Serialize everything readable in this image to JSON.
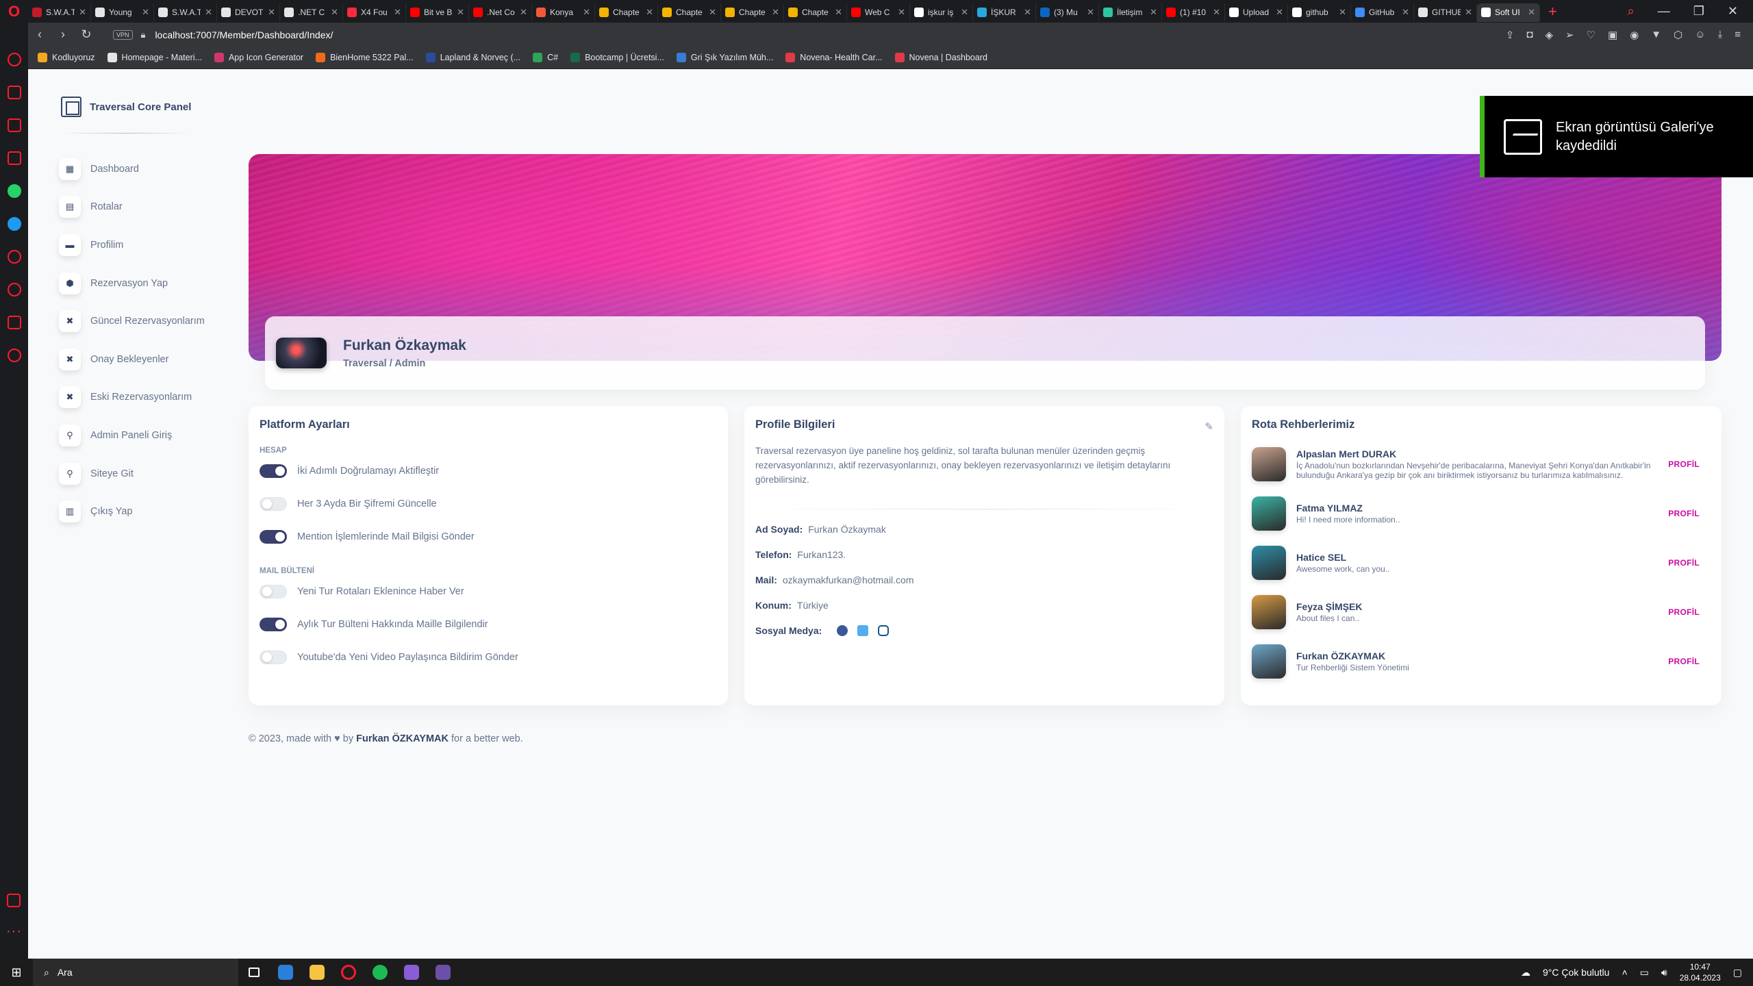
{
  "browser": {
    "tabs": [
      {
        "label": "S.W.A.T.",
        "color": "#c5192d"
      },
      {
        "label": "Young",
        "color": "#e5e5e5"
      },
      {
        "label": "S.W.A.T.",
        "color": "#e5e5e5"
      },
      {
        "label": "DEVOT",
        "color": "#e5e5e5"
      },
      {
        "label": ".NET C",
        "color": "#e5e5e5"
      },
      {
        "label": "X4 Fou",
        "color": "#ff2a3a"
      },
      {
        "label": "Bit ve B",
        "color": "#ff0000"
      },
      {
        "label": ".Net Co",
        "color": "#ff0000"
      },
      {
        "label": "Konya",
        "color": "#f05a3a"
      },
      {
        "label": "Chapte",
        "color": "#f2b400"
      },
      {
        "label": "Chapte",
        "color": "#f2b400"
      },
      {
        "label": "Chapte",
        "color": "#f2b400"
      },
      {
        "label": "Chapte",
        "color": "#f2b400"
      },
      {
        "label": "Web C",
        "color": "#ff0000"
      },
      {
        "label": "işkur iş",
        "color": "#ffffff"
      },
      {
        "label": "İŞKUR",
        "color": "#2aa6e0"
      },
      {
        "label": "(3) Mu",
        "color": "#0a66c2"
      },
      {
        "label": "İletişim",
        "color": "#2ec5a5"
      },
      {
        "label": "(1) #10",
        "color": "#ff0000"
      },
      {
        "label": "Upload",
        "color": "#ffffff"
      },
      {
        "label": "github",
        "color": "#ffffff"
      },
      {
        "label": "GitHub",
        "color": "#3d8bfd"
      },
      {
        "label": "GITHUB",
        "color": "#e5e5e5"
      },
      {
        "label": "Soft UI",
        "color": "#ffffff",
        "active": true
      }
    ],
    "url": "localhost:7007/Member/Dashboard/Index/",
    "vpn_label": "VPN",
    "bookmarks": [
      {
        "label": "Kodluyoruz",
        "color": "#f5a623"
      },
      {
        "label": "Homepage - Materi...",
        "color": "#e5e5e5"
      },
      {
        "label": "App Icon Generator",
        "color": "#d0386c"
      },
      {
        "label": "BienHome 5322 Pal...",
        "color": "#f06a1a"
      },
      {
        "label": "Lapland & Norveç (...",
        "color": "#2b4b9b"
      },
      {
        "label": "C#",
        "color": "#2ea35a"
      },
      {
        "label": "Bootcamp | Ücretsi...",
        "color": "#1a6a4a"
      },
      {
        "label": "Gri Şık Yazılım Müh...",
        "color": "#3a7bd5"
      },
      {
        "label": "Novena- Health Car...",
        "color": "#e23a4a"
      },
      {
        "label": "Novena | Dashboard",
        "color": "#e23a4a"
      }
    ]
  },
  "brand": {
    "title": "Traversal Core Panel"
  },
  "sidebar": {
    "items": [
      {
        "label": "Dashboard",
        "icon": "store-icon"
      },
      {
        "label": "Rotalar",
        "icon": "chart-icon"
      },
      {
        "label": "Profilim",
        "icon": "card-icon"
      },
      {
        "label": "Rezervasyon Yap",
        "icon": "box-icon"
      },
      {
        "label": "Güncel Rezervasyonlarım",
        "icon": "tools-icon"
      },
      {
        "label": "Onay Bekleyenler",
        "icon": "tools-icon"
      },
      {
        "label": "Eski Rezervasyonlarım",
        "icon": "tools-icon"
      },
      {
        "label": "Admin Paneli Giriş",
        "icon": "user-plus-icon"
      },
      {
        "label": "Siteye Git",
        "icon": "user-plus-icon"
      },
      {
        "label": "Çıkış Yap",
        "icon": "document-icon"
      }
    ]
  },
  "profile": {
    "name": "Furkan Özkaymak",
    "role": "Traversal / Admin"
  },
  "platform": {
    "title": "Platform Ayarları",
    "account_label": "HESAP",
    "account_settings": [
      {
        "label": "İki Adımlı Doğrulamayı Aktifleştir",
        "enabled": true
      },
      {
        "label": "Her 3 Ayda Bir Şifremi Güncelle",
        "enabled": false
      },
      {
        "label": "Mention İşlemlerinde Mail Bilgisi Gönder",
        "enabled": true
      }
    ],
    "mail_label": "MAIL BÜLTENİ",
    "mail_settings": [
      {
        "label": "Yeni Tur Rotaları Eklenince Haber Ver",
        "enabled": false
      },
      {
        "label": "Aylık Tur Bülteni Hakkında Maille Bilgilendir",
        "enabled": true
      },
      {
        "label": "Youtube'da Yeni Video Paylaşınca Bildirim Gönder",
        "enabled": false
      }
    ]
  },
  "profile_info": {
    "title": "Profile Bilgileri",
    "description": "Traversal rezervasyon üye paneline hoş geldiniz, sol tarafta bulunan menüler üzerinden geçmiş rezervasyonlarınızı, aktif rezervasyonlarınızı, onay bekleyen rezervasyonlarınızı ve iletişim detaylarını görebilirsiniz.",
    "fields": [
      {
        "key": "Ad Soyad:",
        "value": "Furkan Özkaymak"
      },
      {
        "key": "Telefon:",
        "value": "Furkan123."
      },
      {
        "key": "Mail:",
        "value": "ozkaymakfurkan@hotmail.com"
      },
      {
        "key": "Konum:",
        "value": "Türkiye"
      }
    ],
    "social_label": "Sosyal Medya:"
  },
  "guides": {
    "title": "Rota Rehberlerimiz",
    "button_label": "PROFİL",
    "items": [
      {
        "name": "Alpaslan Mert DURAK",
        "desc": "İç Anadolu'nun bozkırlarından Nevşehir'de peribacalarına, Maneviyat Şehri Konya'dan Anıtkabir'in bulunduğu Ankara'ya gezip bir çok anı biriktirmek istiyorsanız bu turlarımıza katılmalısınız.",
        "color": "#c9a38f"
      },
      {
        "name": "Fatma YILMAZ",
        "desc": "Hi! I need more information..",
        "color": "#3bb3a4"
      },
      {
        "name": "Hatice SEL",
        "desc": "Awesome work, can you..",
        "color": "#2c8fa8"
      },
      {
        "name": "Feyza ŞİMŞEK",
        "desc": "About files I can..",
        "color": "#d59a45"
      },
      {
        "name": "Furkan ÖZKAYMAK",
        "desc": "Tur Rehberliği Sistem Yönetimi",
        "color": "#6ea6c8"
      }
    ]
  },
  "footer": {
    "prefix": "© 2023, made with",
    "by": "by",
    "author": "Furkan ÖZKAYMAK",
    "suffix": "for a better web."
  },
  "toast": {
    "text": "Ekran görüntüsü Galeri'ye kaydedildi"
  },
  "taskbar": {
    "search_label": "Ara",
    "weather": "9°C  Çok bulutlu",
    "time": "10:47",
    "date": "28.04.2023"
  }
}
